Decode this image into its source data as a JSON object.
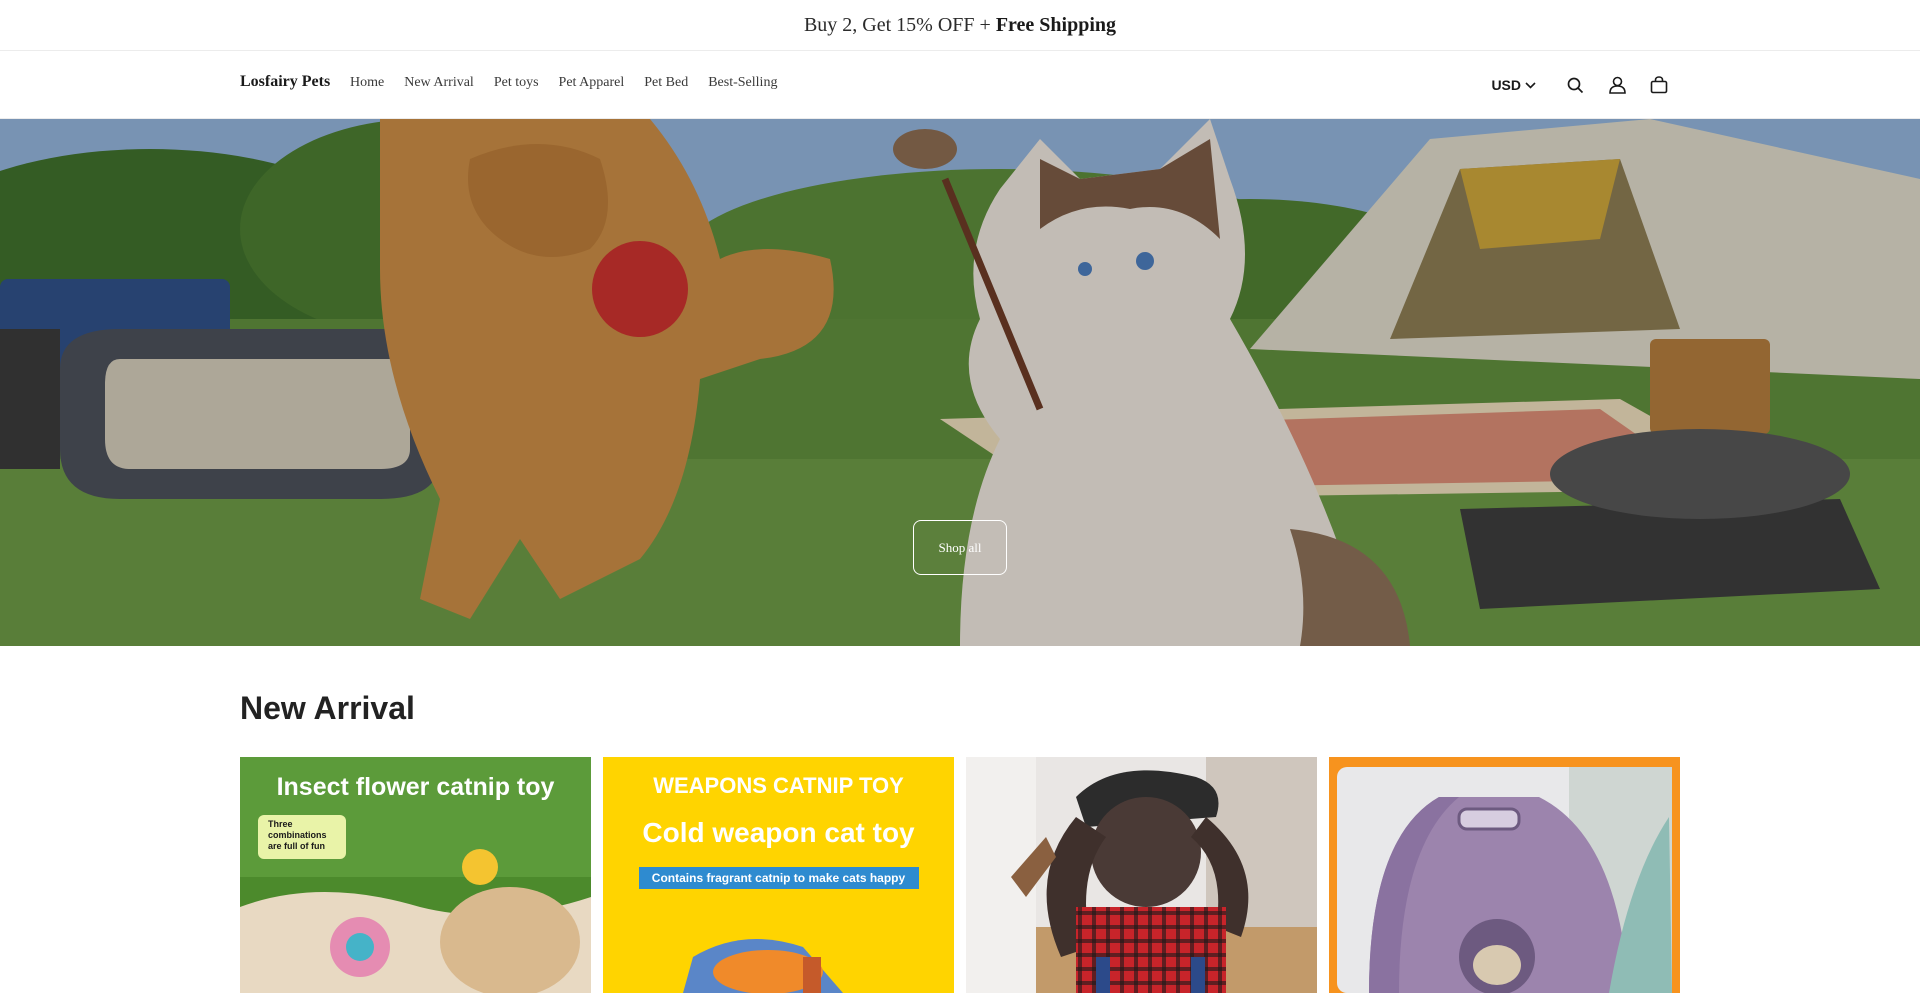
{
  "announcement": {
    "text": "Buy 2, Get 15% OFF +",
    "bold": "Free Shipping"
  },
  "header": {
    "brand": "Losfairy Pets",
    "nav": [
      {
        "label": "Home"
      },
      {
        "label": "New Arrival"
      },
      {
        "label": "Pet toys"
      },
      {
        "label": "Pet Apparel"
      },
      {
        "label": "Pet Bed"
      },
      {
        "label": "Best-Selling"
      }
    ],
    "currency": "USD",
    "icons": [
      "search-icon",
      "account-icon",
      "cart-icon"
    ]
  },
  "hero": {
    "button_label": "Shop all"
  },
  "new_arrival": {
    "title": "New Arrival",
    "products": [
      {
        "image_text": "Insect flower catnip toy",
        "badge": "Three combinations are full of fun"
      },
      {
        "image_text": "WEAPONS CATNIP TOY",
        "subtitle": "Cold weapon cat toy",
        "banner": "Contains fragrant catnip to make cats happy"
      },
      {},
      {}
    ]
  },
  "colors": {
    "accent_yellow": "#ffd400",
    "accent_orange": "#f7931e",
    "text": "#121212"
  }
}
